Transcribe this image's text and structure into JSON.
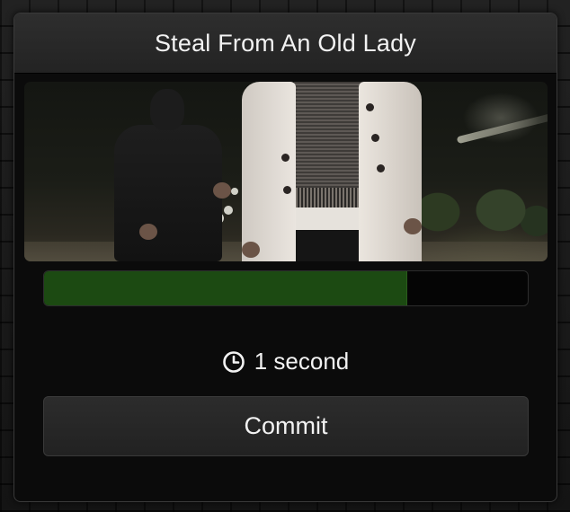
{
  "card": {
    "title": "Steal From An Old Lady"
  },
  "scene": {
    "icon": "crime-scene-photo",
    "description_alt": ""
  },
  "progress": {
    "fraction": 0.75,
    "fill_color": "#1c4a12",
    "track_color": "#050505"
  },
  "timer": {
    "icon": "clock-icon",
    "label": "1 second"
  },
  "actions": {
    "commit_label": "Commit"
  }
}
